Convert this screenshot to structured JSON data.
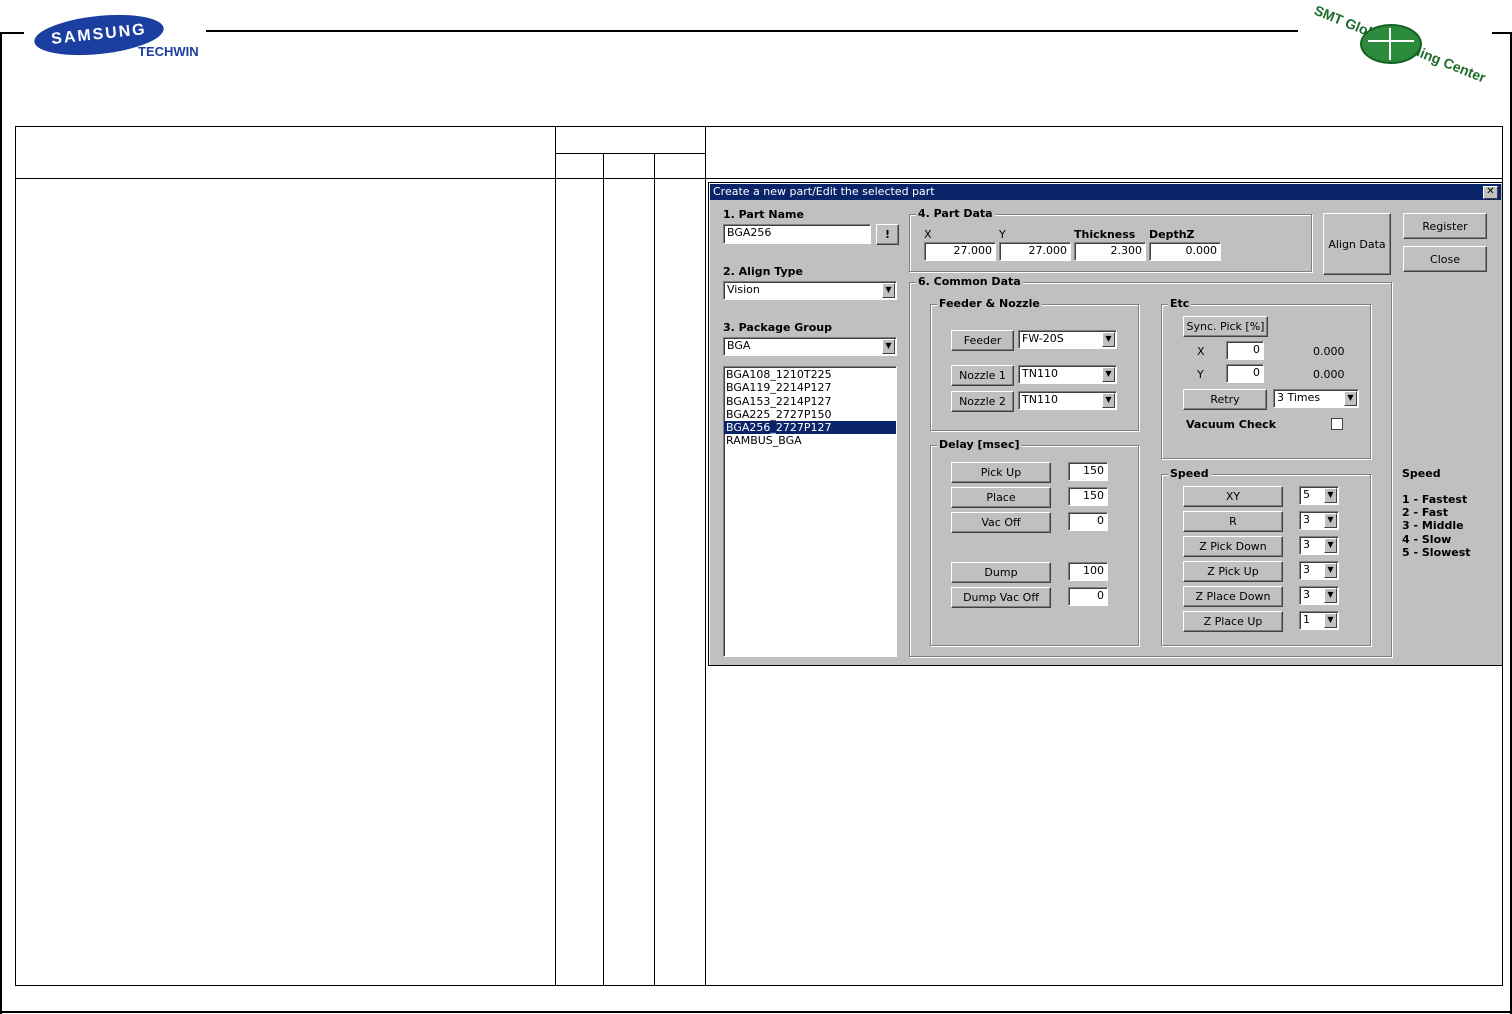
{
  "header": {
    "brand": "SAMSUNG",
    "brand_sub": "TECHWIN",
    "training_center": "SMT Global Training Center"
  },
  "dialog": {
    "title": "Create a new part/Edit the selected part",
    "close_glyph": "✕",
    "part_name": {
      "label": "1. Part Name",
      "value": "BGA256",
      "button": "!"
    },
    "align_type": {
      "label": "2. Align Type",
      "value": "Vision"
    },
    "package_group": {
      "label": "3. Package Group",
      "value": "BGA",
      "items": [
        "BGA108_1210T225",
        "BGA119_2214P127",
        "BGA153_2214P127",
        "BGA225_2727P150",
        "BGA256_2727P127",
        "RAMBUS_BGA"
      ],
      "selected_index": 4
    },
    "part_data": {
      "label": "4. Part Data",
      "x_label": "X",
      "y_label": "Y",
      "thickness_label": "Thickness",
      "depthz_label": "DepthZ",
      "x": "27.000",
      "y": "27.000",
      "thickness": "2.300",
      "depthz": "0.000"
    },
    "buttons": {
      "align_data": "Align Data",
      "register": "Register",
      "close": "Close"
    },
    "common_data": {
      "label": "6. Common Data",
      "feeder_nozzle": {
        "title": "Feeder & Nozzle",
        "feeder_label": "Feeder",
        "feeder_value": "FW-20S",
        "nozzle1_label": "Nozzle 1",
        "nozzle1_value": "TN110",
        "nozzle2_label": "Nozzle 2",
        "nozzle2_value": "TN110"
      },
      "etc": {
        "title": "Etc",
        "sync_pick": "Sync. Pick [%]",
        "x_label": "X",
        "x_value": "0",
        "x_readout": "0.000",
        "y_label": "Y",
        "y_value": "0",
        "y_readout": "0.000",
        "retry_label": "Retry",
        "retry_value": "3 Times",
        "vacuum_check": "Vacuum Check"
      },
      "delay": {
        "title": "Delay [msec]",
        "pick_up_label": "Pick Up",
        "pick_up": "150",
        "place_label": "Place",
        "place": "150",
        "vac_off_label": "Vac Off",
        "vac_off": "0",
        "dump_label": "Dump",
        "dump": "100",
        "dump_vac_off_label": "Dump Vac Off",
        "dump_vac_off": "0"
      },
      "speed": {
        "title": "Speed",
        "xy_label": "XY",
        "xy": "5",
        "r_label": "R",
        "r": "3",
        "z_pick_down_label": "Z Pick Down",
        "z_pick_down": "3",
        "z_pick_up_label": "Z Pick Up",
        "z_pick_up": "3",
        "z_place_down_label": "Z Place Down",
        "z_place_down": "3",
        "z_place_up_label": "Z Place Up",
        "z_place_up": "1"
      }
    },
    "speed_legend": {
      "title": "Speed",
      "items": [
        "1 - Fastest",
        "2 - Fast",
        "3 - Middle",
        "4 - Slow",
        "5 - Slowest"
      ]
    }
  }
}
